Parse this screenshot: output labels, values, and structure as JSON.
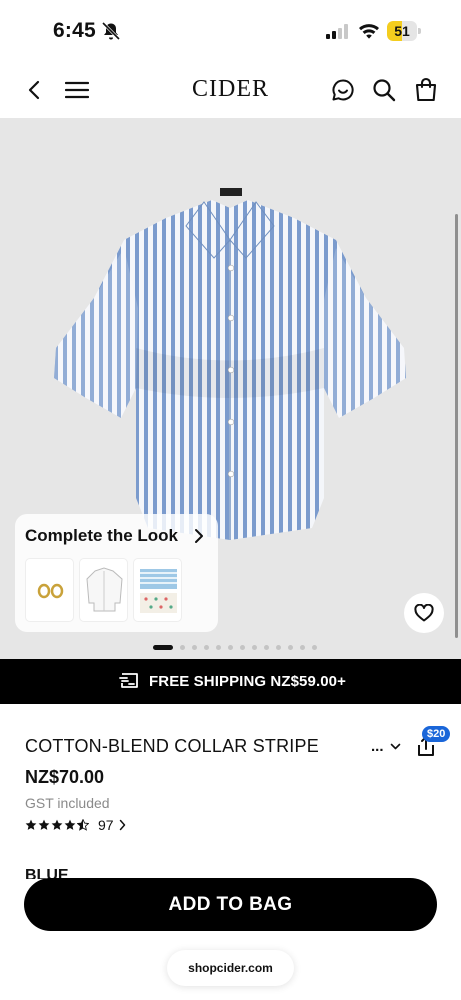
{
  "status_bar": {
    "time": "6:45",
    "battery_level": "51",
    "battery_fraction": 0.51,
    "icons": [
      "bell-slash-icon",
      "signal-icon",
      "wifi-icon",
      "battery-icon"
    ],
    "battery_color": "#f4cd1e"
  },
  "header": {
    "logo": "CIDER",
    "icons": [
      "back-icon",
      "menu-icon",
      "chat-icon",
      "search-icon",
      "shopping-bag-icon"
    ]
  },
  "gallery": {
    "background": "#e6e6e6",
    "image_count": 13,
    "active_index": 0,
    "complete_the_look": {
      "title": "Complete the Look",
      "items": [
        "earrings",
        "white-shirt",
        "striped-set"
      ]
    },
    "wishlist_icon": "heart-icon"
  },
  "shipping_bar": {
    "text": "FREE SHIPPING NZ$59.00+",
    "icon": "shipping-truck-icon"
  },
  "product": {
    "title": "COTTON-BLEND COLLAR STRIPE",
    "more_label": "...",
    "share_badge": "$20",
    "price": "NZ$70.00",
    "tax_note": "GST included",
    "rating": 4.5,
    "review_count": "97",
    "color_label": "BLUE"
  },
  "actions": {
    "add_to_bag": "ADD TO BAG"
  },
  "browser": {
    "url": "shopcider.com"
  },
  "colors": {
    "accent": "#000000",
    "badge": "#1a66d9",
    "stripe": "#6f93c9"
  }
}
